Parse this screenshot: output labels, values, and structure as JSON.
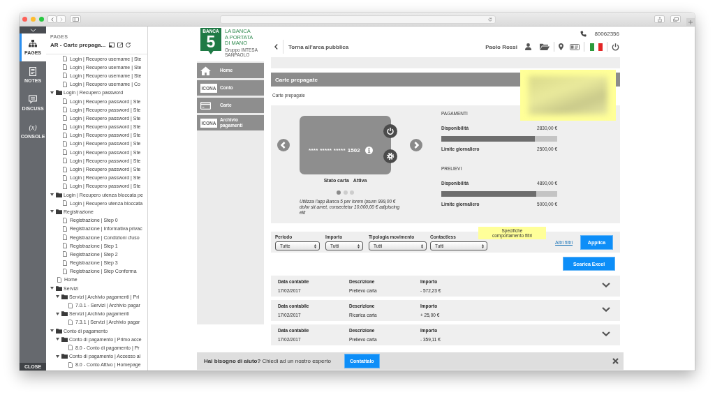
{
  "app_rail": {
    "items": [
      {
        "kind": "pages",
        "label": "PAGES",
        "selected": true
      },
      {
        "kind": "notes",
        "label": "NOTES",
        "selected": false
      },
      {
        "kind": "discuss",
        "label": "DISCUSS",
        "selected": false
      },
      {
        "kind": "console",
        "glyph": "(x)",
        "label": "CONSOLE",
        "selected": false
      }
    ],
    "close": "CLOSE"
  },
  "pages_panel": {
    "heading": "PAGES",
    "project": "AR - Carte prepaga...",
    "tree": [
      {
        "children": [
          {
            "label": "Login | Recupero username | Ste",
            "kind": "page"
          },
          {
            "label": "Login | Recupero username | Ste",
            "kind": "page"
          },
          {
            "label": "Login | Recupero username | Ste",
            "kind": "page"
          },
          {
            "label": "Login | Recupero username | Co",
            "kind": "page"
          }
        ]
      },
      {
        "label": "Login | Recupero password",
        "kind": "folder",
        "expanded": true,
        "children": [
          {
            "label": "Login | Recupero password | Ste",
            "kind": "page"
          },
          {
            "label": "Login | Recupero password | Ste",
            "kind": "page"
          },
          {
            "label": "Login | Recupero password | Ste",
            "kind": "page"
          },
          {
            "label": "Login | Recupero password | Ste",
            "kind": "page"
          },
          {
            "label": "Login | Recupero password | Ste",
            "kind": "page"
          },
          {
            "label": "Login | Recupero password | Ste",
            "kind": "page"
          },
          {
            "label": "Login | Recupero password | Ste",
            "kind": "page"
          },
          {
            "label": "Login | Recupero password | Ste",
            "kind": "page"
          },
          {
            "label": "Login | Recupero password | Ste",
            "kind": "page"
          },
          {
            "label": "Login | Recupero password | Ste",
            "kind": "page"
          },
          {
            "label": "Login | Recupero password | Ste",
            "kind": "page"
          }
        ]
      },
      {
        "label": "Login | Recupero utenza bloccata pe",
        "kind": "folder",
        "expanded": true,
        "children": [
          {
            "label": "Login | Recupero utenza bloccata",
            "kind": "page"
          }
        ]
      },
      {
        "label": "Registrazione",
        "kind": "folder",
        "expanded": true,
        "children": [
          {
            "label": "Registrazione | Step 0",
            "kind": "page"
          },
          {
            "label": "Registrazione | Informativa privac",
            "kind": "page"
          },
          {
            "label": "Registrazione | Condizioni d'uso",
            "kind": "page"
          },
          {
            "label": "Registrazione | Step 1",
            "kind": "page"
          },
          {
            "label": "Registrazione | Step 2",
            "kind": "page"
          },
          {
            "label": "Registrazione | Step 3",
            "kind": "page"
          },
          {
            "label": "Registrazione | Step Conferma",
            "kind": "page"
          }
        ]
      },
      {
        "label": "Home",
        "kind": "page"
      },
      {
        "label": "Servizi",
        "kind": "folder",
        "expanded": true,
        "children": [
          {
            "label": "Servizi | Archivio pagamenti | Pri",
            "kind": "folder",
            "expanded": true,
            "children": [
              {
                "label": "7.0.1 - Servizi | Archivio pagar",
                "kind": "page"
              }
            ]
          },
          {
            "label": "Servizi | Archivio pagamenti",
            "kind": "folder",
            "expanded": true,
            "children": [
              {
                "label": "7.3.1 | Servizi | Archivio pagar",
                "kind": "page"
              }
            ]
          }
        ]
      },
      {
        "label": "Conto di pagamento",
        "kind": "folder",
        "expanded": true,
        "children": [
          {
            "label": "Conto di pagamento | Primo acce",
            "kind": "folder",
            "expanded": true,
            "children": [
              {
                "label": "8.0 - Conto di pagamento | Pr",
                "kind": "page"
              }
            ]
          },
          {
            "label": "Conto di pagamento | Accesso al",
            "kind": "folder",
            "expanded": true,
            "children": [
              {
                "label": "8.0 - Conto Attivo | Homepage",
                "kind": "page"
              }
            ]
          }
        ]
      }
    ]
  },
  "site": {
    "logo": {
      "badge_top": "BANCA",
      "badge_number": "5",
      "lines": [
        "LA BANCA",
        "A PORTATA",
        "DI MANO"
      ],
      "tagline": "Gruppo INTESA SANPAOLO"
    },
    "phone": "80062356",
    "back_link": "Torna all'area pubblica",
    "user_name": "Paolo Rossi",
    "nav": [
      {
        "label": "Home",
        "kind": "home"
      },
      {
        "label": "Conto",
        "kind": "placeholder",
        "icon_text": "ICONA"
      },
      {
        "label": "Carte",
        "kind": "card"
      },
      {
        "label": "Archivio pagamenti",
        "kind": "placeholder",
        "icon_text": "ICONA"
      }
    ],
    "page_title": "Carte prepagate",
    "breadcrumb": "Carte prepagate",
    "card": {
      "masked": "**** ***** *****",
      "last_digits": "1502",
      "status_label": "Stato carta",
      "status": "Attiva",
      "dots": [
        {
          "selected": true
        },
        {
          "selected": false
        },
        {
          "selected": false
        }
      ],
      "note": "Utilizza l'app Banca 5 per lorem ipsum 999,00 € dolor sit amet, consectetur 10.000,00 € adipiscing elit"
    },
    "limits": [
      {
        "title": "PAGAMENTI",
        "available_label": "Disponibilità",
        "available": "2830,00 €",
        "level": 0.81,
        "limit_label": "Limite giornaliero",
        "limit": "2500,00 €"
      },
      {
        "title": "PRELIEVI",
        "available_label": "Disponibilità",
        "available": "4890,00 €",
        "level": 0.82,
        "limit_label": "Limite giornaliero",
        "limit": "5000,00 €"
      }
    ],
    "filters": [
      {
        "label": "Periodo",
        "value": "Tutte"
      },
      {
        "label": "Importo",
        "value": "Tutti"
      },
      {
        "label": "Tipologia movimento",
        "value": "Tutti"
      },
      {
        "label": "Contactless",
        "value": "Tutti"
      }
    ],
    "filter_note": "Specifiche comportamento filtri",
    "more_filters": "Altri filtri",
    "apply": "Applica",
    "export": "Scarica Excel",
    "movements": [
      {
        "date_label": "Data contabile",
        "date": "17/02/2017",
        "description_label": "Descrizione",
        "description": "Prelievo carta",
        "amount_label": "Importo",
        "amount": "- 572,23 €"
      },
      {
        "date_label": "Data contabile",
        "date": "17/02/2017",
        "description_label": "Descrizione",
        "description": "Ricarica carta",
        "amount_label": "Importo",
        "amount": "+ 25,00 €"
      },
      {
        "date_label": "Data contabile",
        "date": "17/02/2017",
        "description_label": "Descrizione",
        "description": "Prelievo carta",
        "amount_label": "Importo",
        "amount": "- 359,11 €"
      }
    ],
    "help": {
      "text": "**Hai bisogno di aiuto?** Chiedi ad un nostro esperto",
      "button": "Contattalo"
    }
  }
}
